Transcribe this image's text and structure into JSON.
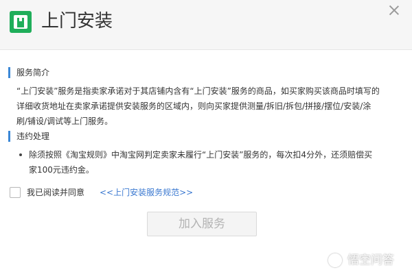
{
  "dialog": {
    "title": "上门安装",
    "icon": "install-tool-icon",
    "close_icon": "close-icon"
  },
  "sections": {
    "intro": {
      "title": "服务简介",
      "lines": [
        "“上门安装”服务是指卖家承诺对于其店铺内含有“上门安装”服务的商品，如买家购买该商品时填写的",
        "详细收货地址在卖家承诺提供安装服务的区域内，则向买家提供测量/拆旧/拆包/拼接/摆位/安装/涂",
        "刷/铺设/调试等上门服务。"
      ]
    },
    "violation": {
      "title": "违约处理",
      "bullet_lines": [
        "除须按照《淘宝规则》中淘宝网判定卖家未履行“上门安装”服务的，每次扣4分外，还须赔偿买",
        "家100元违约金。"
      ]
    }
  },
  "agreement": {
    "label": "我已阅读并同意",
    "link": "<<上门安装服务规范>>",
    "checked": false
  },
  "buttons": {
    "join": "加入服务"
  },
  "watermark": {
    "text": "悟空问答"
  },
  "colors": {
    "brand_green": "#1fae5a",
    "accent_blue": "#3a87d6",
    "link_blue": "#3a78d0",
    "disabled_text": "#b3b3b3"
  }
}
